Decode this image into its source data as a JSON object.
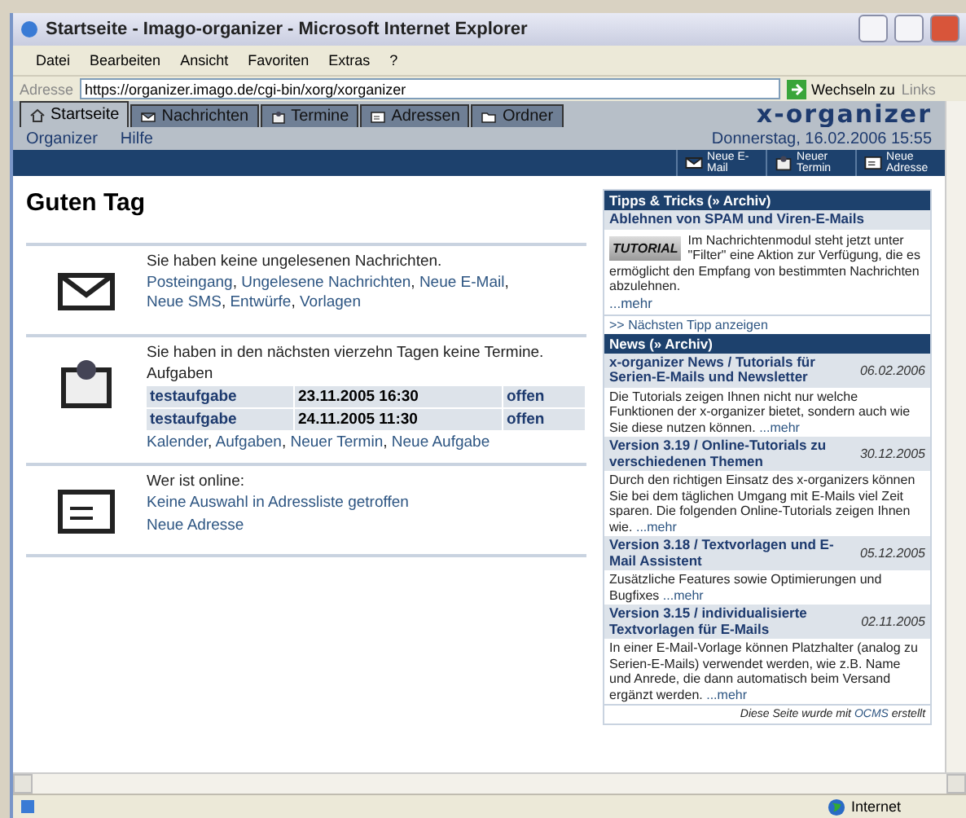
{
  "window": {
    "title": "Startseite - Imago-organizer - Microsoft Internet Explorer"
  },
  "menu": [
    "Datei",
    "Bearbeiten",
    "Ansicht",
    "Favoriten",
    "Extras",
    "?"
  ],
  "address_bar": {
    "label": "Adresse",
    "value": "https://organizer.imago.de/cgi-bin/xorg/xorganizer",
    "go_button": "Wechseln zu",
    "links": "Links"
  },
  "tabs": [
    {
      "label": "Startseite",
      "selected": true
    },
    {
      "label": "Nachrichten",
      "selected": false
    },
    {
      "label": "Termine",
      "selected": false
    },
    {
      "label": "Adressen",
      "selected": false
    },
    {
      "label": "Ordner",
      "selected": false
    }
  ],
  "logo": "x-organizer",
  "subnav": [
    "Organizer",
    "Hilfe"
  ],
  "datetime": "Donnerstag, 16.02.2006 15:55",
  "actions": [
    {
      "label": "Neue E-Mail"
    },
    {
      "label": "Neuer Termin"
    },
    {
      "label": "Neue Adresse"
    }
  ],
  "heading": "Guten Tag",
  "link_separator": ",",
  "sections": [
    {
      "message": "Sie haben keine ungelesenen Nachrichten.",
      "link_rows": [
        [
          "Posteingang",
          "Ungelesene Nachrichten",
          "Neue E-Mail",
          "Neue SMS",
          "Entwürfe",
          "Vorlagen"
        ]
      ]
    },
    {
      "message": "Sie haben in den nächsten vierzehn Tagen keine Termine.",
      "tasks_label": "Aufgaben",
      "tasks": [
        {
          "name": "testaufgabe",
          "date": "23.11.2005 16:30",
          "status": "offen"
        },
        {
          "name": "testaufgabe",
          "date": "24.11.2005 11:30",
          "status": "offen"
        }
      ],
      "link_rows": [
        [
          "Kalender",
          "Aufgaben",
          "Neuer Termin",
          "Neue Aufgabe"
        ]
      ]
    },
    {
      "message": "Wer ist online:",
      "link_rows": [
        [
          "Keine Auswahl in Adressliste getroffen"
        ],
        [
          "Neue Adresse"
        ]
      ]
    }
  ],
  "tips": {
    "header": "Tipps & Tricks (» Archiv)",
    "title": "Ablehnen von SPAM und Viren-E-Mails",
    "badge": "TUTORIAL",
    "text": "Im Nachrichtenmodul steht jetzt unter \"Filter\" eine Aktion zur Verfügung, die es ermöglicht den Empfang von bestimmten Nachrichten abzulehnen.",
    "more": "...mehr",
    "next": ">> Nächsten Tipp anzeigen"
  },
  "news": {
    "header": "News (» Archiv)",
    "items": [
      {
        "title": "x-organizer News / Tutorials für Serien-E-Mails und Newsletter",
        "date": "06.02.2006",
        "text": "Die Tutorials zeigen Ihnen nicht nur welche Funktionen der x-organizer bietet, sondern auch wie Sie diese nutzen können.",
        "more": "...mehr"
      },
      {
        "title": "Version 3.19 / Online-Tutorials zu verschiedenen Themen",
        "date": "30.12.2005",
        "text": "Durch den richtigen Einsatz des x-organizers können Sie bei dem täglichen Umgang mit E-Mails viel Zeit sparen. Die folgenden Online-Tutorials zeigen Ihnen wie.",
        "more": "...mehr"
      },
      {
        "title": "Version 3.18 / Textvorlagen und E-Mail Assistent",
        "date": "05.12.2005",
        "text": "Zusätzliche Features sowie Optimierungen und Bugfixes",
        "more": "...mehr"
      },
      {
        "title": "Version 3.15 / individualisierte Textvorlagen für E-Mails",
        "date": "02.11.2005",
        "text": "In einer E-Mail-Vorlage können Platzhalter (analog zu Serien-E-Mails) verwendet werden, wie z.B. Name und Anrede, die dann automatisch beim Versand ergänzt werden.",
        "more": "...mehr"
      }
    ]
  },
  "footer": {
    "before": "Diese Seite wurde mit",
    "link": "OCMS",
    "after": "erstellt"
  },
  "status_bar": {
    "zone": "Internet"
  }
}
